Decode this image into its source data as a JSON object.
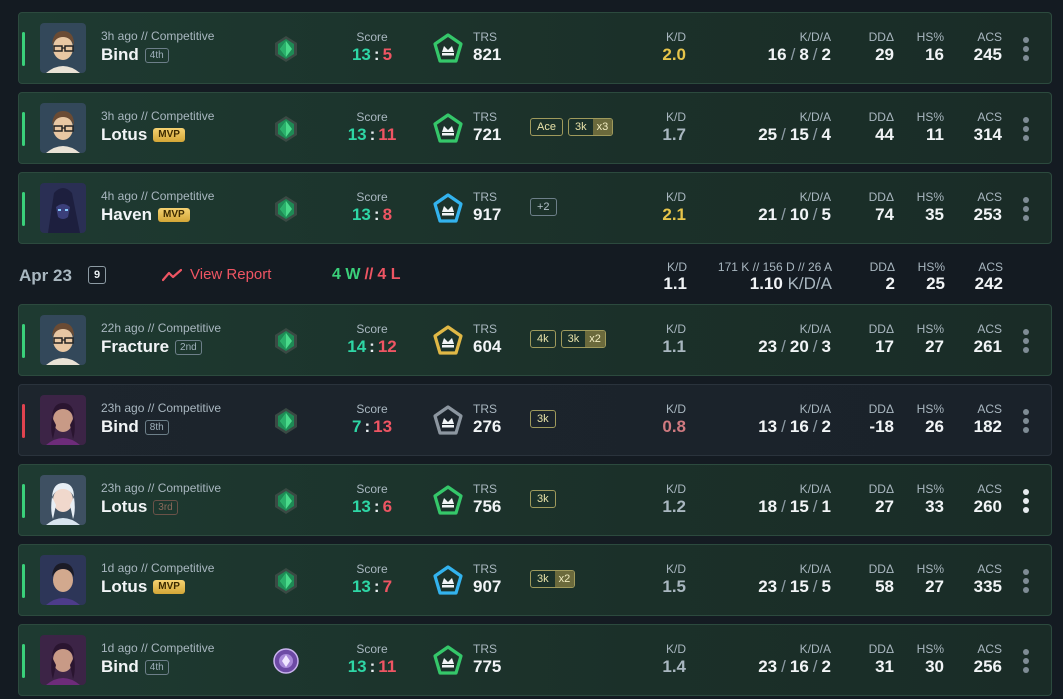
{
  "day_header": {
    "date": "Apr 23",
    "count": "9",
    "view_report": "View Report",
    "wins": "4 W",
    "sep": "//",
    "losses": "4 L",
    "kd_label": "K/D",
    "kd": "1.1",
    "kda_label": "171 K // 156 D // 26 A",
    "kda": "1.10",
    "kda_suffix": "K/D/A",
    "dd_label": "DDΔ",
    "dd": "2",
    "hs_label": "HS%",
    "hs": "25",
    "acs_label": "ACS",
    "acs": "242"
  },
  "labels": {
    "score": "Score",
    "trs": "TRS",
    "kd": "K/D",
    "kda": "K/D/A",
    "dd": "DDΔ",
    "hs": "HS%",
    "acs": "ACS"
  },
  "matches": [
    {
      "result": "win",
      "agent": "chamber",
      "meta": "3h ago // Competitive",
      "map": "Bind",
      "place": "4th",
      "mvp": "",
      "rank": "emerald-icon",
      "score_w": "13",
      "score_l": "5",
      "trs_tier": "green",
      "trs": "821",
      "badges": [],
      "kd": "2.0",
      "kd_color": "gold",
      "k": "16",
      "d": "8",
      "a": "2",
      "dd": "29",
      "hs": "16",
      "acs": "245"
    },
    {
      "result": "win",
      "agent": "chamber",
      "meta": "3h ago // Competitive",
      "map": "Lotus",
      "place": "",
      "mvp": "MVP",
      "rank": "emerald-icon",
      "score_w": "13",
      "score_l": "11",
      "trs_tier": "green",
      "trs": "721",
      "badges": [
        {
          "t": "Ace",
          "m": ""
        },
        {
          "t": "3k",
          "m": "x3"
        }
      ],
      "kd": "1.7",
      "kd_color": "gray",
      "k": "25",
      "d": "15",
      "a": "4",
      "dd": "44",
      "hs": "11",
      "acs": "314"
    },
    {
      "result": "win",
      "agent": "omen",
      "meta": "4h ago // Competitive",
      "map": "Haven",
      "place": "",
      "mvp": "MVP",
      "rank": "emerald-icon",
      "score_w": "13",
      "score_l": "8",
      "trs_tier": "blue",
      "trs": "917",
      "badges": [
        {
          "t": "+2",
          "m": "",
          "g": true
        }
      ],
      "kd": "2.1",
      "kd_color": "gold",
      "k": "21",
      "d": "10",
      "a": "5",
      "dd": "74",
      "hs": "35",
      "acs": "253"
    },
    {
      "result": "win",
      "agent": "chamber",
      "meta": "22h ago // Competitive",
      "map": "Fracture",
      "place": "2nd",
      "mvp": "",
      "rank": "emerald-icon",
      "score_w": "14",
      "score_l": "12",
      "trs_tier": "gold",
      "trs": "604",
      "badges": [
        {
          "t": "4k",
          "m": ""
        },
        {
          "t": "3k",
          "m": "x2"
        }
      ],
      "kd": "1.1",
      "kd_color": "gray",
      "k": "23",
      "d": "20",
      "a": "3",
      "dd": "17",
      "hs": "27",
      "acs": "261"
    },
    {
      "result": "loss",
      "agent": "reyna",
      "meta": "23h ago // Competitive",
      "map": "Bind",
      "place": "8th",
      "mvp": "",
      "rank": "emerald-icon",
      "score_w": "7",
      "score_l": "13",
      "trs_tier": "gray",
      "trs": "276",
      "badges": [
        {
          "t": "3k",
          "m": ""
        }
      ],
      "kd": "0.8",
      "kd_color": "red",
      "k": "13",
      "d": "16",
      "a": "2",
      "dd": "-18",
      "hs": "26",
      "acs": "182"
    },
    {
      "result": "win",
      "agent": "jett",
      "meta": "23h ago // Competitive",
      "map": "Lotus",
      "place": "3rd",
      "place_dim": true,
      "mvp": "",
      "rank": "emerald-icon",
      "score_w": "13",
      "score_l": "6",
      "trs_tier": "green",
      "trs": "756",
      "badges": [
        {
          "t": "3k",
          "m": ""
        }
      ],
      "kd": "1.2",
      "kd_color": "gray",
      "k": "18",
      "d": "15",
      "a": "1",
      "dd": "27",
      "hs": "33",
      "acs": "260",
      "more_bright": true
    },
    {
      "result": "win",
      "agent": "iso",
      "meta": "1d ago // Competitive",
      "map": "Lotus",
      "place": "",
      "mvp": "MVP",
      "rank": "emerald-icon",
      "score_w": "13",
      "score_l": "7",
      "trs_tier": "blue",
      "trs": "907",
      "badges": [
        {
          "t": "3k",
          "m": "x2"
        }
      ],
      "kd": "1.5",
      "kd_color": "gray",
      "k": "23",
      "d": "15",
      "a": "5",
      "dd": "58",
      "hs": "27",
      "acs": "335"
    },
    {
      "result": "win",
      "agent": "reyna",
      "meta": "1d ago // Competitive",
      "map": "Bind",
      "place": "4th",
      "mvp": "",
      "rank": "ascendant-icon",
      "score_w": "13",
      "score_l": "11",
      "trs_tier": "green",
      "trs": "775",
      "badges": [],
      "kd": "1.4",
      "kd_color": "gray",
      "k": "23",
      "d": "16",
      "a": "2",
      "dd": "31",
      "hs": "30",
      "acs": "256"
    }
  ]
}
